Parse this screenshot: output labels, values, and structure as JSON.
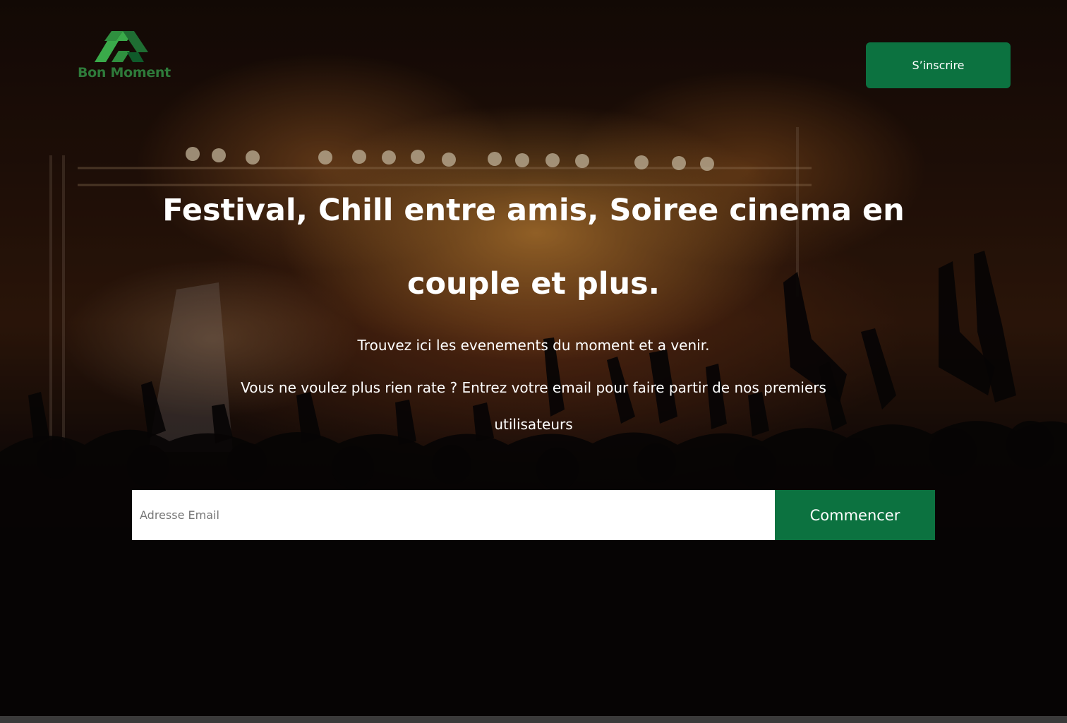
{
  "header": {
    "logo_text": "Bon Moment",
    "signup_label": "S’inscrire"
  },
  "hero": {
    "title": "Festival, Chill entre amis, Soiree cinema en couple et plus.",
    "subtitle": "Trouvez ici les evenements du moment et a venir.",
    "cta_text": "Vous ne voulez plus rien rate ? Entrez votre email pour faire partir de nos premiers utilisateurs"
  },
  "signup_form": {
    "email_placeholder": "Adresse Email",
    "submit_label": "Commencer"
  },
  "colors": {
    "brand_green": "#0c7240",
    "logo_green": "#2e7a3a",
    "logo_green_light": "#3aaa4a"
  },
  "icons": {
    "logo": "bon-moment-logo-icon"
  }
}
